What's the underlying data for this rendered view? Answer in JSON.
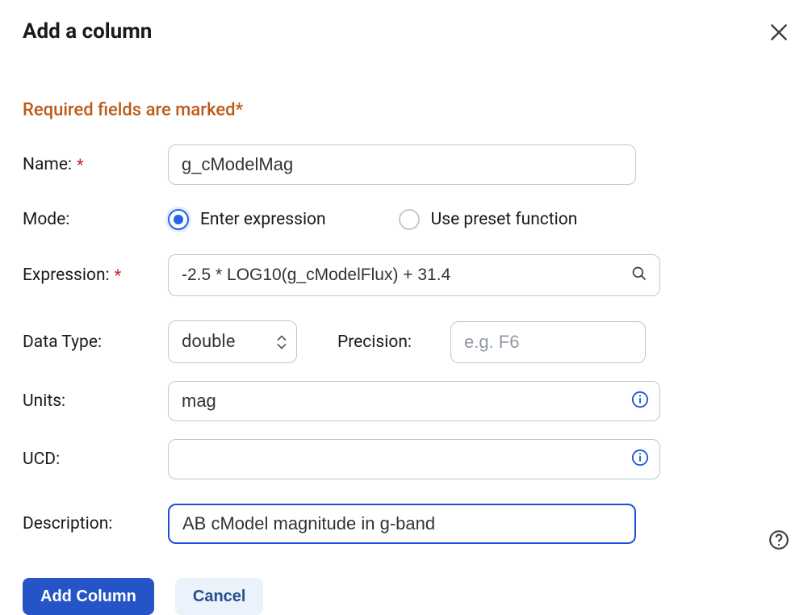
{
  "dialog": {
    "title": "Add a column",
    "required_hint": "Required fields are marked*"
  },
  "fields": {
    "name": {
      "label": "Name:",
      "value": "g_cModelMag"
    },
    "mode": {
      "label": "Mode:",
      "option_expression": "Enter expression",
      "option_preset": "Use preset function"
    },
    "expression": {
      "label": "Expression:",
      "value": "-2.5 * LOG10(g_cModelFlux) + 31.4"
    },
    "datatype": {
      "label": "Data Type:",
      "value": "double"
    },
    "precision": {
      "label": "Precision:",
      "placeholder": "e.g. F6"
    },
    "units": {
      "label": "Units:",
      "value": "mag"
    },
    "ucd": {
      "label": "UCD:",
      "value": ""
    },
    "description": {
      "label": "Description:",
      "value": "AB cModel magnitude in g-band"
    }
  },
  "buttons": {
    "primary": "Add Column",
    "secondary": "Cancel"
  }
}
